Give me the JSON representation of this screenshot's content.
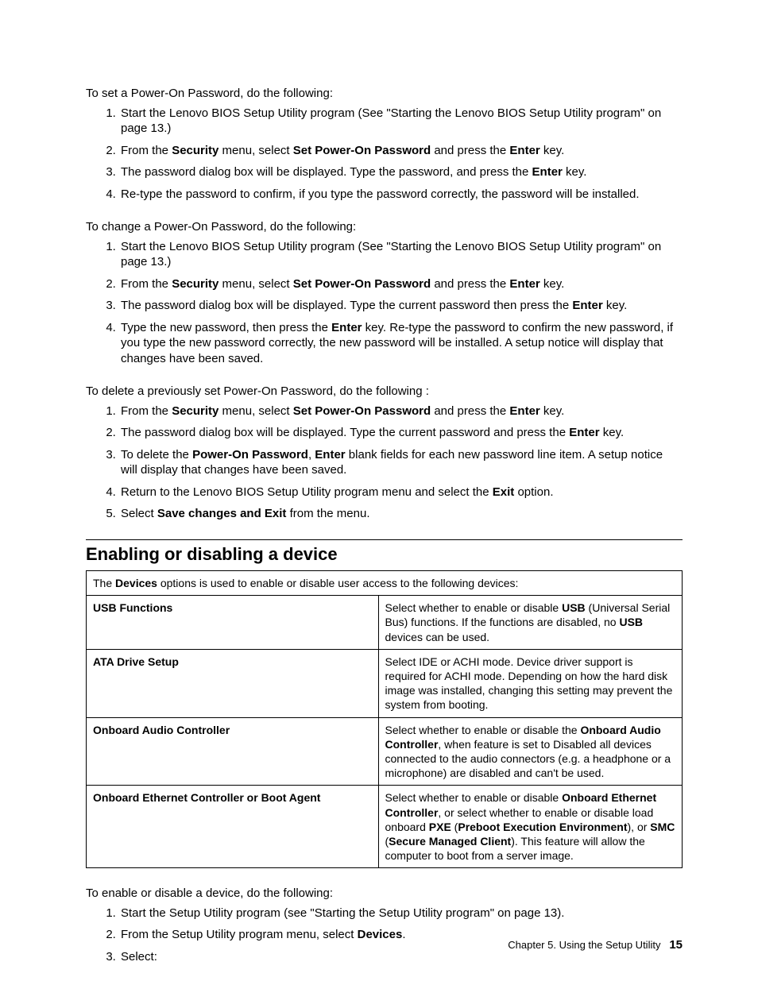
{
  "section1": {
    "intro": "To set a Power-On Password, do the following:",
    "items": [
      {
        "pre": "Start the Lenovo BIOS Setup Utility program (See \"Starting the Lenovo BIOS Setup Utility program\" on page 13.)"
      },
      {
        "pre": "From the ",
        "b1": "Security",
        "mid1": " menu, select ",
        "b2": "Set Power-On Password",
        "mid2": " and press the ",
        "b3": "Enter",
        "post": " key."
      },
      {
        "pre": "The password dialog box will be displayed. Type the password, and press the ",
        "b1": "Enter",
        "post": " key."
      },
      {
        "pre": "Re-type the password to confirm, if you type the password correctly, the password will be installed."
      }
    ]
  },
  "section2": {
    "intro": "To change a Power-On Password, do the following:",
    "items": [
      {
        "pre": "Start the Lenovo BIOS Setup Utility program (See \"Starting the Lenovo BIOS Setup Utility program\" on page 13.)"
      },
      {
        "pre": "From the ",
        "b1": "Security",
        "mid1": " menu, select ",
        "b2": "Set Power-On Password",
        "mid2": " and press the ",
        "b3": "Enter",
        "post": " key."
      },
      {
        "pre": "The password dialog box will be displayed. Type the current password then press the ",
        "b1": "Enter",
        "post": " key."
      },
      {
        "pre": "Type the new password, then press the ",
        "b1": "Enter",
        "post": " key. Re-type the password to confirm the new password, if you type the new password correctly, the new password will be installed. A setup notice will display that changes have been saved."
      }
    ]
  },
  "section3": {
    "intro": "To delete a previously set Power-On Password, do the following :",
    "items": [
      {
        "pre": "From the ",
        "b1": "Security",
        "mid1": " menu, select ",
        "b2": "Set Power-On Password",
        "mid2": " and press the ",
        "b3": "Enter",
        "post": " key."
      },
      {
        "pre": "The password dialog box will be displayed. Type the current password and press the ",
        "b1": "Enter",
        "post": " key."
      },
      {
        "pre": "To delete the ",
        "b1": "Power-On Password",
        "mid1": ", ",
        "b2": "Enter",
        "post": " blank fields for each new password line item. A setup notice will display that changes have been saved."
      },
      {
        "pre": "Return to the Lenovo BIOS Setup Utility program menu and select the ",
        "b1": "Exit",
        "post": " option."
      },
      {
        "pre": "Select ",
        "b1": "Save changes and Exit",
        "post": " from the menu."
      }
    ]
  },
  "heading": "Enabling or disabling a device",
  "table": {
    "intro_pre": "The ",
    "intro_b": "Devices",
    "intro_post": " options is used to enable or disable user access to the following devices:",
    "rows": [
      {
        "left": "USB Functions",
        "r_pre": "Select whether to enable or disable ",
        "r_b1": "USB",
        "r_mid1": " (Universal Serial Bus) functions. If the functions are disabled, no ",
        "r_b2": "USB",
        "r_post": " devices can be used."
      },
      {
        "left": "ATA Drive Setup",
        "r_pre": "Select IDE or ACHI mode. Device driver support is required for ACHI mode. Depending on how the hard disk image was installed, changing this setting may prevent the system from booting."
      },
      {
        "left": "Onboard Audio Controller",
        "r_pre": "Select whether to enable or disable the ",
        "r_b1": "Onboard Audio Controller",
        "r_post": ", when feature is set to Disabled all devices connected to the audio connectors (e.g. a headphone or a microphone) are disabled and can't be used."
      },
      {
        "left": "Onboard Ethernet Controller or Boot Agent",
        "r_pre": "Select whether to enable or disable ",
        "r_b1": "Onboard Ethernet Controller",
        "r_mid1": ", or select whether to enable or disable load onboard ",
        "r_b2": "PXE",
        "r_mid2": " (",
        "r_b3": "Preboot Execution Environment",
        "r_mid3": "), or ",
        "r_b4": "SMC",
        "r_mid4": " (",
        "r_b5": "Secure Managed Client",
        "r_post": "). This feature will allow the computer to boot from a server image."
      }
    ]
  },
  "section4": {
    "intro": "To enable or disable a device, do the following:",
    "items": [
      {
        "pre": "Start the Setup Utility program (see \"Starting the Setup Utility program\" on page 13)."
      },
      {
        "pre": "From the Setup Utility program menu, select ",
        "b1": "Devices",
        "post": "."
      },
      {
        "pre": "Select:"
      }
    ]
  },
  "footer": {
    "chap": "Chapter 5. Using the Setup Utility",
    "page": "15"
  }
}
